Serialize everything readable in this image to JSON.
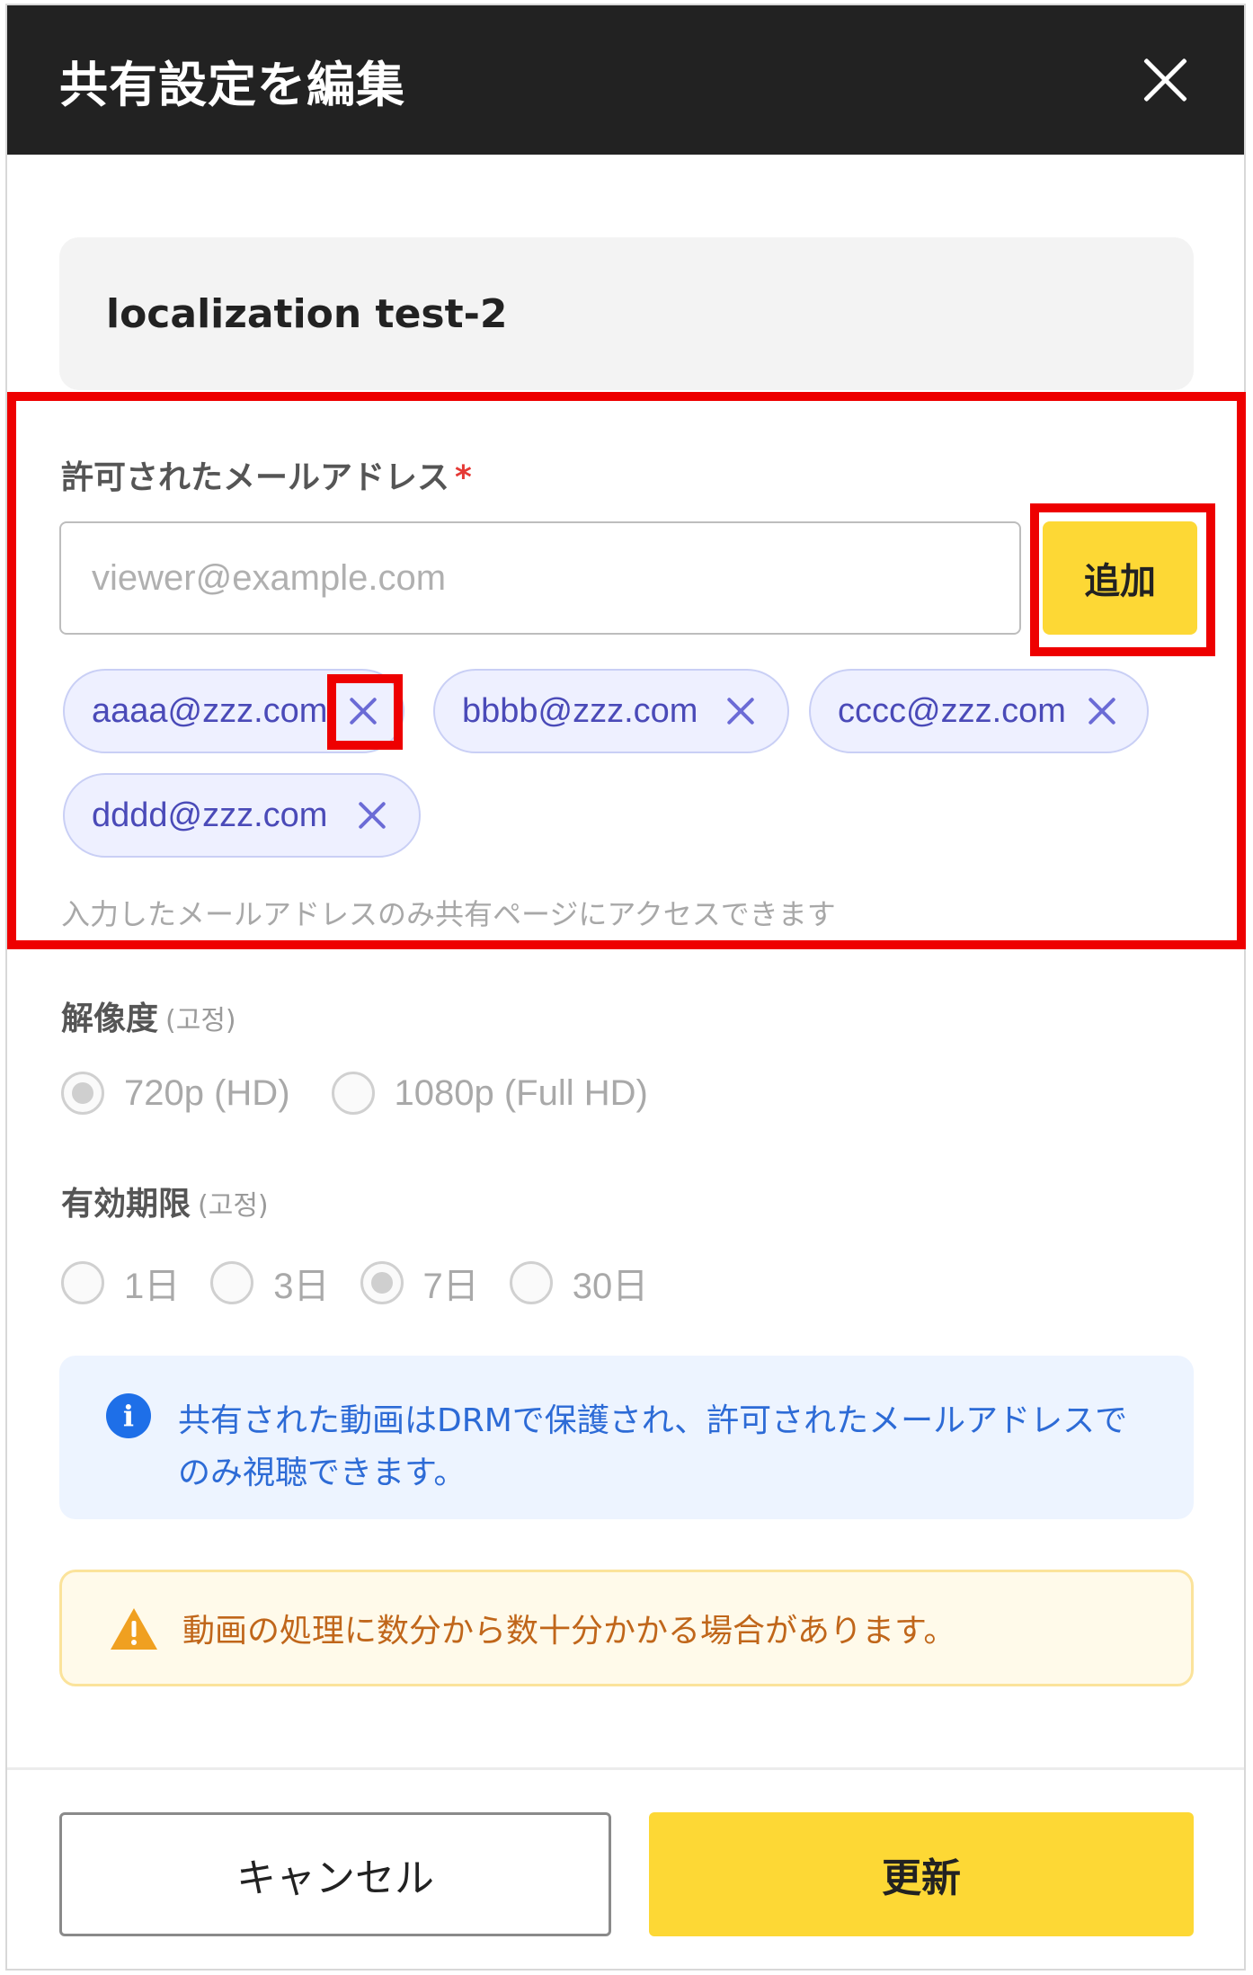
{
  "header": {
    "title": "共有設定を編集"
  },
  "share_name": "localization test-2",
  "emails": {
    "label": "許可されたメールアドレス",
    "required_mark": "*",
    "input_placeholder": "viewer@example.com",
    "input_value": "",
    "add_label": "追加",
    "chips": [
      "aaaa@zzz.com",
      "bbbb@zzz.com",
      "cccc@zzz.com",
      "dddd@zzz.com"
    ],
    "hint": "入力したメールアドレスのみ共有ページにアクセスできます"
  },
  "resolution": {
    "label": "解像度",
    "fixed_note": "(고정)",
    "options": [
      "720p (HD)",
      "1080p (Full HD)"
    ],
    "selected": "720p (HD)"
  },
  "expiry": {
    "label": "有効期限",
    "fixed_note": "(고정)",
    "options": [
      "1日",
      "3日",
      "7日",
      "30日"
    ],
    "selected": "7日"
  },
  "info": {
    "icon_name": "info-icon",
    "text": "共有された動画はDRMで保護され、許可されたメールアドレスでのみ視聴できます。"
  },
  "warning": {
    "icon_name": "warning-icon",
    "text": "動画の処理に数分から数十分かかる場合があります。"
  },
  "footer": {
    "cancel_label": "キャンセル",
    "update_label": "更新"
  },
  "colors": {
    "header_bg": "#222222",
    "accent_yellow": "#fdd835",
    "chip_text": "#4a4ab8",
    "info_blue": "#1e6fe8",
    "warning_orange": "#f0a020",
    "highlight_red": "#ee0000"
  }
}
